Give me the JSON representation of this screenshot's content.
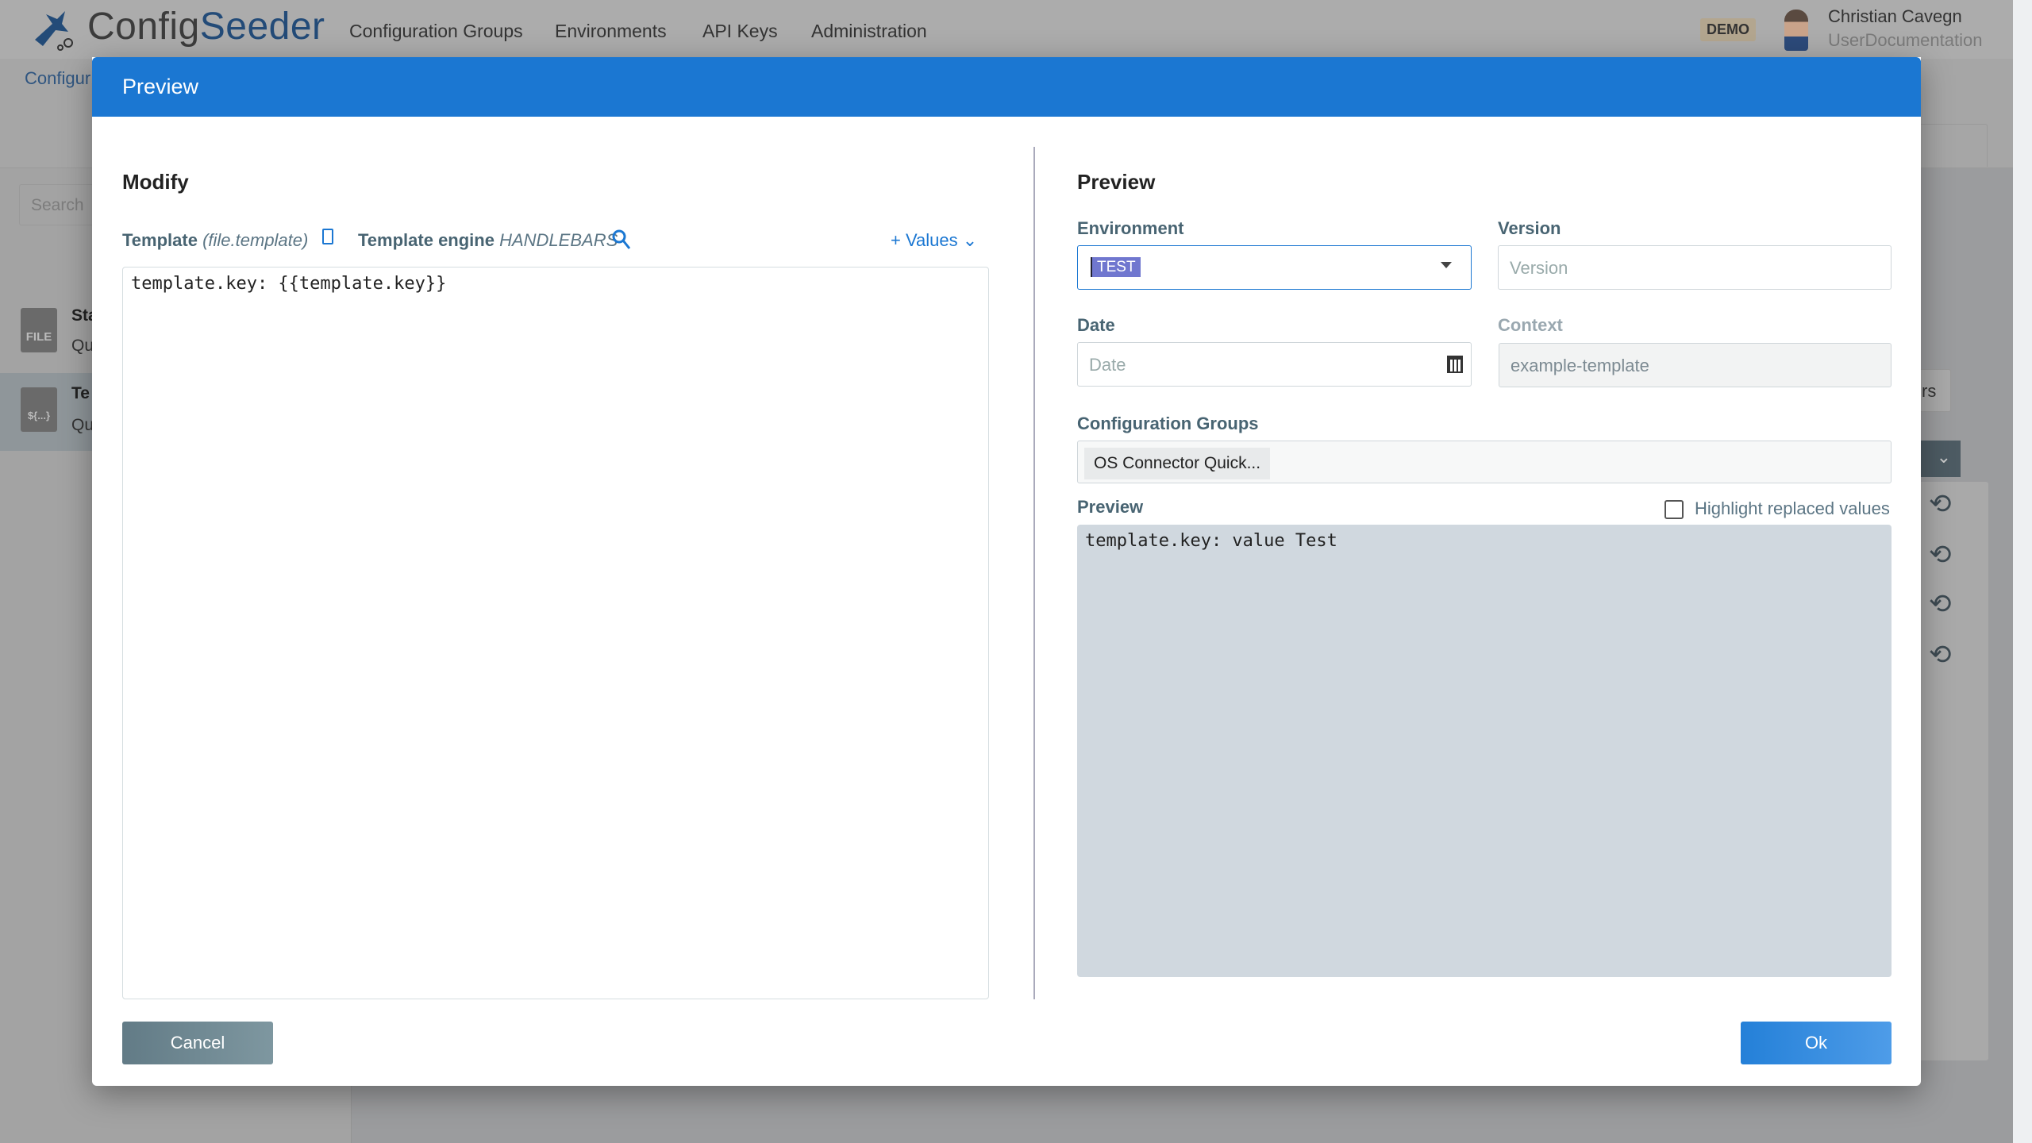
{
  "header": {
    "logo_part1": "Config",
    "logo_part2": "Seeder",
    "nav": [
      "Configuration Groups",
      "Environments",
      "API Keys",
      "Administration"
    ],
    "badge": "DEMO",
    "user_name": "Christian Cavegn",
    "user_org": "UserDocumentation"
  },
  "background": {
    "breadcrumb": "Configur",
    "search_placeholder": "Search",
    "items": [
      {
        "icon": "FILE",
        "title": "Sta",
        "sub": "Qu"
      },
      {
        "icon": "${...}",
        "title": "Te",
        "sub": "Qu"
      }
    ],
    "button_partial": "rs"
  },
  "modal": {
    "title": "Preview",
    "left": {
      "heading": "Modify",
      "template_label": "Template",
      "template_file": "(file.template)",
      "engine_label": "Template engine",
      "engine_value": "HANDLEBARS",
      "values_button": "+ Values",
      "template_content": "template.key: {{template.key}}"
    },
    "right": {
      "heading": "Preview",
      "environment_label": "Environment",
      "environment_value": "TEST",
      "version_label": "Version",
      "version_placeholder": "Version",
      "date_label": "Date",
      "date_placeholder": "Date",
      "context_label": "Context",
      "context_value": "example-template",
      "groups_label": "Configuration Groups",
      "groups_chip": "OS Connector Quick...",
      "preview_label": "Preview",
      "highlight_label": "Highlight replaced values",
      "highlight_checked": false,
      "preview_content": "template.key: value Test"
    },
    "cancel": "Cancel",
    "ok": "Ok"
  },
  "colors": {
    "accent": "#1b77d2",
    "env_chip": "#7077cf"
  }
}
